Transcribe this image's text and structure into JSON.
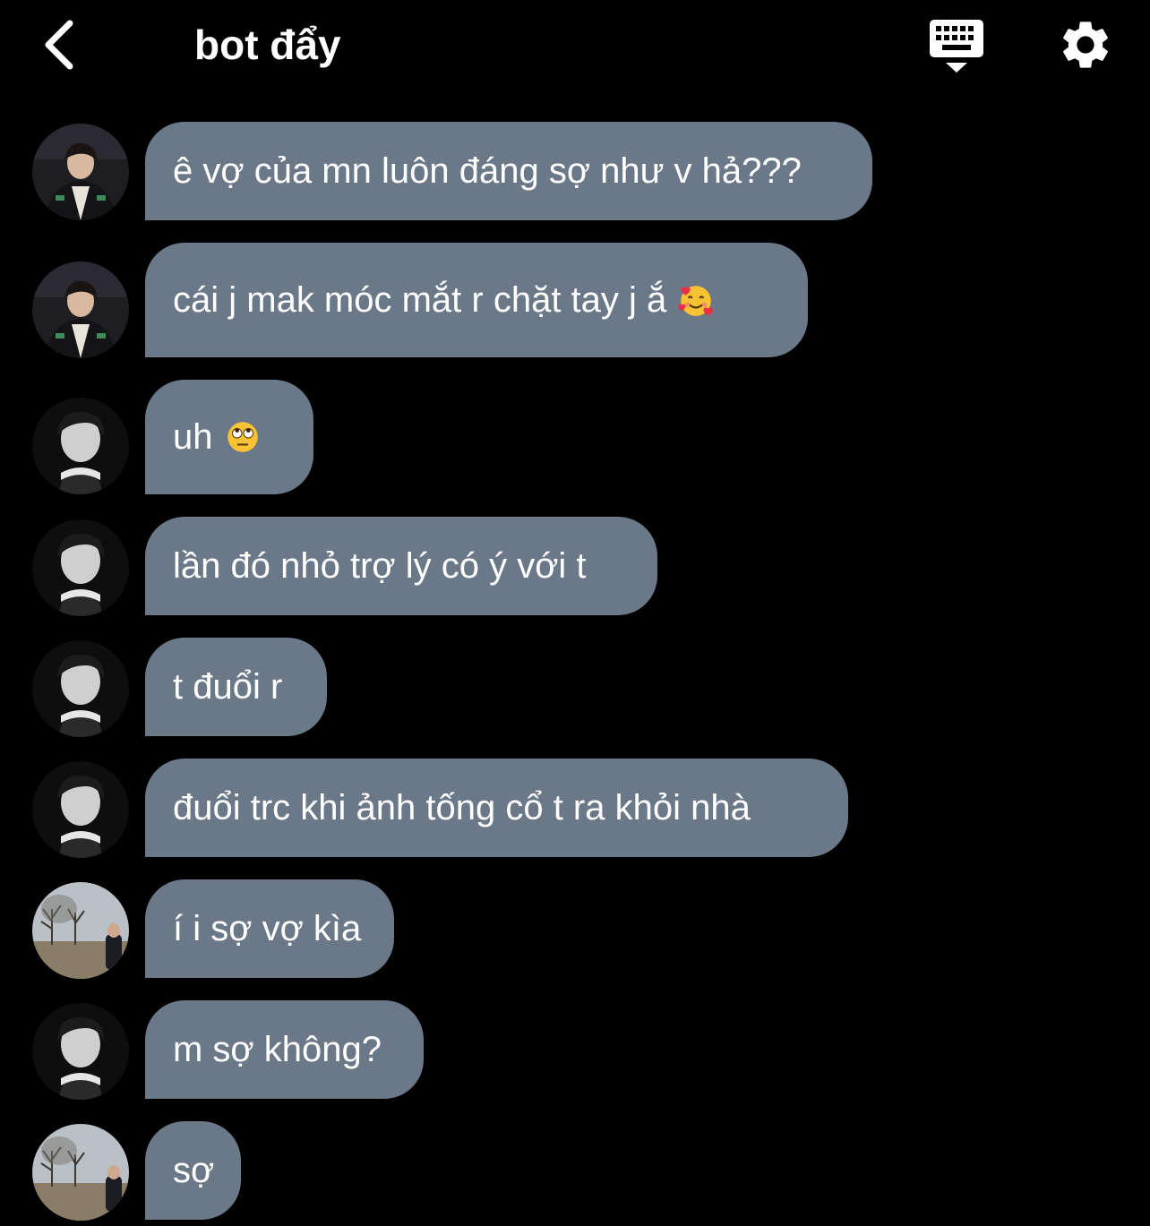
{
  "header": {
    "title": "bot đẩy",
    "back_icon": "chevron-left-icon",
    "keyboard_icon": "keyboard-icon",
    "settings_icon": "gear-icon"
  },
  "colors": {
    "background": "#000000",
    "bubble": "#6a7888",
    "text": "#ffffff"
  },
  "messages": [
    {
      "avatar": "avatar-a",
      "text": "ê vợ của mn luôn đáng sợ như v hả???",
      "emoji": ""
    },
    {
      "avatar": "avatar-a",
      "text": "cái j mak móc mắt r chặt tay j ắ",
      "emoji": "smiling-face-with-hearts"
    },
    {
      "avatar": "avatar-b",
      "text": "uh",
      "emoji": "face-with-rolling-eyes"
    },
    {
      "avatar": "avatar-b",
      "text": "lần đó nhỏ trợ lý có ý với t",
      "emoji": ""
    },
    {
      "avatar": "avatar-b",
      "text": "t đuổi r",
      "emoji": ""
    },
    {
      "avatar": "avatar-b",
      "text": "đuổi trc khi ảnh tống cổ t ra khỏi nhà",
      "emoji": ""
    },
    {
      "avatar": "avatar-c",
      "text": "í i sợ vợ kìa",
      "emoji": ""
    },
    {
      "avatar": "avatar-b",
      "text": "m sợ không?",
      "emoji": ""
    },
    {
      "avatar": "avatar-c",
      "text": "sợ",
      "emoji": ""
    }
  ]
}
